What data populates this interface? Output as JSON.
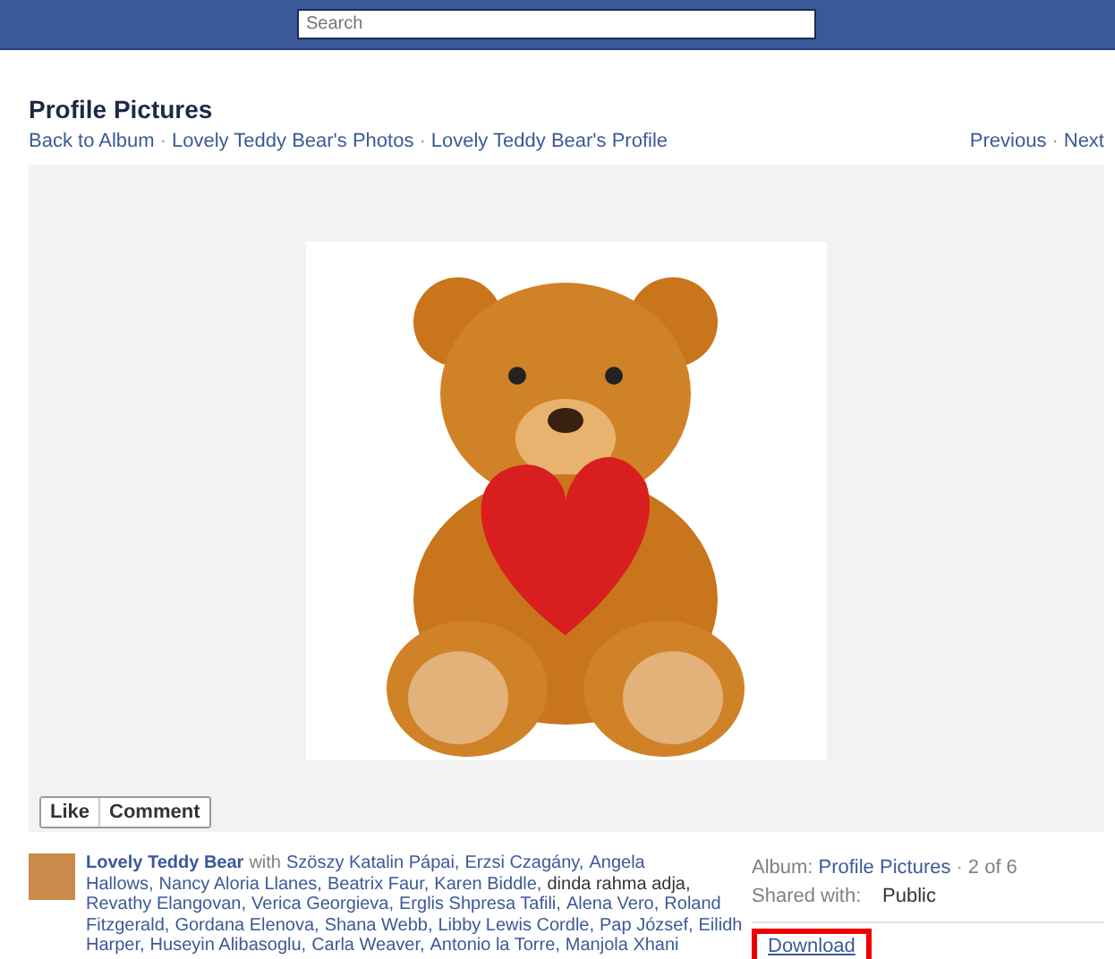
{
  "header": {
    "search": {
      "placeholder": "Search"
    }
  },
  "title": "Profile Pictures",
  "breadcrumbs": [
    "Back to Album",
    "Lovely Teddy Bear's Photos",
    "Lovely Teddy Bear's Profile"
  ],
  "pager": [
    "Previous",
    "Next"
  ],
  "link_separator": "·",
  "actions": [
    "Like",
    "Comment"
  ],
  "caption_lines": [
    [
      {
        "kind": "owner",
        "text": "Lovely Teddy Bear"
      },
      {
        "kind": "with",
        "text": "with"
      },
      {
        "kind": "link",
        "text": "Szöszy Katalin Pápai,"
      },
      {
        "kind": "link",
        "text": "Erzsi Czagány,"
      },
      {
        "kind": "link",
        "text": "Angela"
      }
    ],
    [
      {
        "kind": "link",
        "text": "Hallows,"
      },
      {
        "kind": "link",
        "text": "Nancy Aloria Llanes,"
      },
      {
        "kind": "link",
        "text": "Beatrix Faur,"
      },
      {
        "kind": "link",
        "text": "Karen Biddle,"
      },
      {
        "kind": "plain",
        "text": "dinda rahma adja,"
      }
    ],
    [
      {
        "kind": "link",
        "text": "Revathy Elangovan,"
      },
      {
        "kind": "link",
        "text": "Verica Georgieva,"
      },
      {
        "kind": "link",
        "text": "Erglis Shpresa Tafili,"
      },
      {
        "kind": "link",
        "text": "Alena Vero,"
      },
      {
        "kind": "link",
        "text": "Roland"
      }
    ],
    [
      {
        "kind": "link",
        "text": "Fitzgerald,"
      },
      {
        "kind": "link",
        "text": "Gordana Elenova,"
      },
      {
        "kind": "link",
        "text": "Shana Webb,"
      },
      {
        "kind": "link",
        "text": "Libby Lewis Cordle,"
      },
      {
        "kind": "link",
        "text": "Pap József,"
      },
      {
        "kind": "link",
        "text": "Eilidh"
      }
    ],
    [
      {
        "kind": "link",
        "text": "Harper,"
      },
      {
        "kind": "link",
        "text": "Huseyin Alibasoglu,"
      },
      {
        "kind": "link",
        "text": "Carla Weaver,"
      },
      {
        "kind": "link",
        "text": "Antonio la Torre,"
      },
      {
        "kind": "link",
        "text": "Manjola Xhani"
      }
    ]
  ],
  "info": {
    "album_label": "Album:",
    "album": "Profile Pictures",
    "position": "2 of 6",
    "shared_label": "Shared with:",
    "shared": "Public",
    "download": "Download"
  }
}
